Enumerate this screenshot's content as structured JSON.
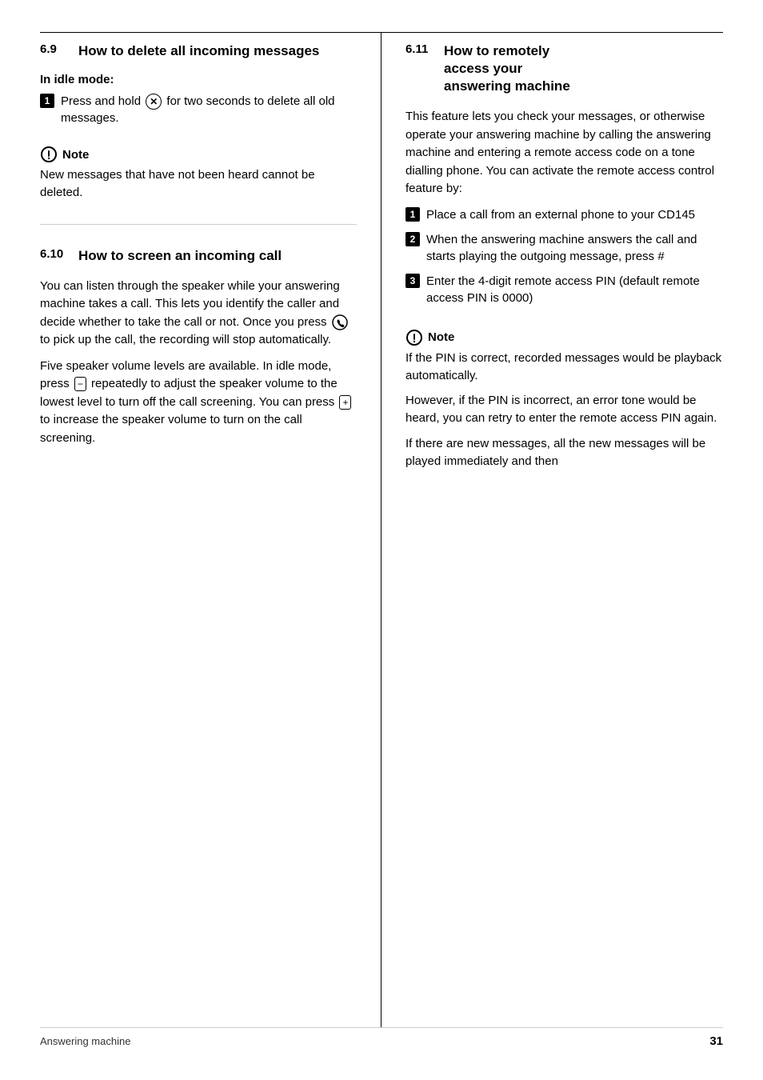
{
  "page": {
    "footer_label": "Answering machine",
    "page_number": "31"
  },
  "left_col": {
    "section_69": {
      "number": "6.9",
      "title": "How to delete all incoming messages",
      "subsection": "In idle mode:",
      "steps": [
        {
          "num": "1",
          "text_parts": [
            "Press and hold ",
            " for two seconds to delete all old messages."
          ]
        }
      ],
      "note_label": "Note",
      "note_text": "New messages that have not been heard cannot be deleted."
    },
    "section_610": {
      "number": "6.10",
      "title": "How to screen an incoming call",
      "body1": "You can listen through the speaker while your answering machine takes a call. This lets you identify the caller and decide whether to take the call or not. Once you press ",
      "body1b": " to pick up the call, the recording will stop automatically.",
      "body2_start": "Five speaker volume levels are available. In idle mode, press ",
      "body2_mid": " repeatedly to adjust the speaker volume to the lowest level to turn off the call screening. You can press ",
      "body2_end": " to increase the speaker volume to turn on the call screening."
    }
  },
  "right_col": {
    "section_611": {
      "number": "6.11",
      "title_line1": "How to remotely",
      "title_line2": "access your",
      "title_line3": "answering machine",
      "intro": "This feature lets you check your messages, or otherwise operate your answering machine by calling the answering machine and entering a remote access code on a tone dialling phone. You can activate the remote access control feature by:",
      "steps": [
        {
          "num": "1",
          "text": "Place a call from an external phone to your CD145"
        },
        {
          "num": "2",
          "text": "When the answering machine answers the call and starts playing the outgoing message, press #"
        },
        {
          "num": "3",
          "text": "Enter the 4-digit remote access PIN (default remote access PIN is 0000)"
        }
      ],
      "note_label": "Note",
      "note_text1": "If the PIN is correct, recorded messages would be playback automatically.",
      "note_text2": "However, if the PIN is incorrect, an error tone would be heard, you can retry to enter the remote access PIN again.",
      "note_text3": "If there are new messages, all the new messages will be played immediately and then"
    }
  }
}
